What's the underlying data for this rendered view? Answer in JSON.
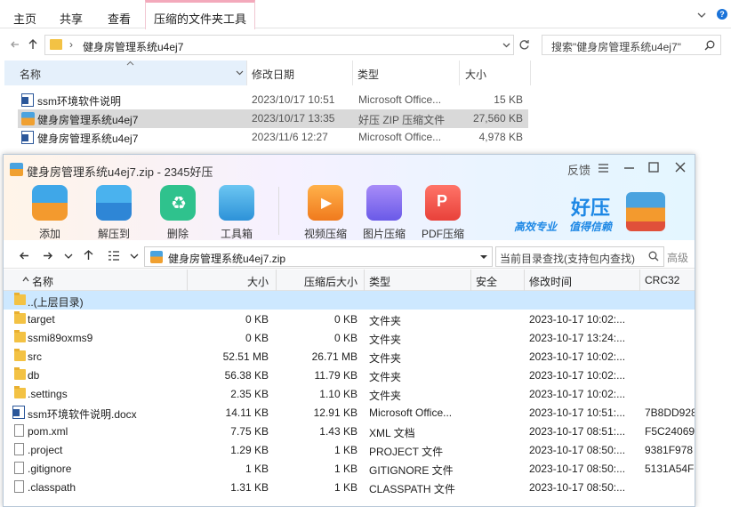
{
  "explorer": {
    "ribbon_tabs": [
      "主页",
      "共享",
      "查看"
    ],
    "active_tab": "压缩的文件夹工具",
    "path_separator": "›",
    "current_folder": "健身房管理系统u4ej7",
    "search_placeholder": "搜索\"健身房管理系统u4ej7\"",
    "columns": {
      "name": "名称",
      "date": "修改日期",
      "type": "类型",
      "size": "大小"
    },
    "files": [
      {
        "name": "ssm环境软件说明",
        "date": "2023/10/17 10:51",
        "type": "Microsoft Office...",
        "size": "15 KB",
        "icon": "word-doc-icon"
      },
      {
        "name": "健身房管理系统u4ej7",
        "date": "2023/10/17 13:35",
        "type": "好压 ZIP 压缩文件",
        "size": "27,560 KB",
        "icon": "zip-archive-icon"
      },
      {
        "name": "健身房管理系统u4ej7",
        "date": "2023/11/6 12:27",
        "type": "Microsoft Office...",
        "size": "4,978 KB",
        "icon": "word-doc-icon"
      }
    ]
  },
  "haozip": {
    "title": "健身房管理系统u4ej7.zip - 2345好压",
    "feedback": "反馈",
    "toolbar": [
      {
        "label": "添加",
        "icon": "add-archive-icon"
      },
      {
        "label": "解压到",
        "icon": "extract-to-icon"
      },
      {
        "label": "删除",
        "icon": "delete-recycle-icon"
      },
      {
        "label": "工具箱",
        "icon": "toolbox-icon"
      },
      {
        "label": "视频压缩",
        "icon": "video-compress-icon"
      },
      {
        "label": "图片压缩",
        "icon": "image-compress-icon"
      },
      {
        "label": "PDF压缩",
        "icon": "pdf-compress-icon"
      }
    ],
    "brand": {
      "name": "好压",
      "slogan1": "高效专业",
      "slogan2": "值得信赖"
    },
    "path": "健身房管理系统u4ej7.zip",
    "search_placeholder": "当前目录查找(支持包内查找)",
    "advanced": "高级",
    "columns": {
      "name": "名称",
      "size": "大小",
      "packed": "压缩后大小",
      "type": "类型",
      "security": "安全",
      "modified": "修改时间",
      "crc": "CRC32"
    },
    "rows": [
      {
        "name": "..(上层目录)",
        "size": "",
        "packed": "",
        "type": "",
        "modified": "",
        "crc": "",
        "icon": "folder"
      },
      {
        "name": "target",
        "size": "0 KB",
        "packed": "0 KB",
        "type": "文件夹",
        "modified": "2023-10-17 10:02:...",
        "crc": "",
        "icon": "folder"
      },
      {
        "name": "ssmi89oxms9",
        "size": "0 KB",
        "packed": "0 KB",
        "type": "文件夹",
        "modified": "2023-10-17 13:24:...",
        "crc": "",
        "icon": "folder"
      },
      {
        "name": "src",
        "size": "52.51 MB",
        "packed": "26.71 MB",
        "type": "文件夹",
        "modified": "2023-10-17 10:02:...",
        "crc": "",
        "icon": "folder"
      },
      {
        "name": "db",
        "size": "56.38 KB",
        "packed": "11.79 KB",
        "type": "文件夹",
        "modified": "2023-10-17 10:02:...",
        "crc": "",
        "icon": "folder"
      },
      {
        "name": ".settings",
        "size": "2.35 KB",
        "packed": "1.10 KB",
        "type": "文件夹",
        "modified": "2023-10-17 10:02:...",
        "crc": "",
        "icon": "folder"
      },
      {
        "name": "ssm环境软件说明.docx",
        "size": "14.11 KB",
        "packed": "12.91 KB",
        "type": "Microsoft Office...",
        "modified": "2023-10-17 10:51:...",
        "crc": "7B8DD928",
        "icon": "word"
      },
      {
        "name": "pom.xml",
        "size": "7.75 KB",
        "packed": "1.43 KB",
        "type": "XML 文档",
        "modified": "2023-10-17 08:51:...",
        "crc": "F5C24069",
        "icon": "file"
      },
      {
        "name": ".project",
        "size": "1.29 KB",
        "packed": "1 KB",
        "type": "PROJECT 文件",
        "modified": "2023-10-17 08:50:...",
        "crc": "9381F978",
        "icon": "file"
      },
      {
        "name": ".gitignore",
        "size": "1 KB",
        "packed": "1 KB",
        "type": "GITIGNORE 文件",
        "modified": "2023-10-17 08:50:...",
        "crc": "5131A54F",
        "icon": "file"
      },
      {
        "name": ".classpath",
        "size": "1.31 KB",
        "packed": "1 KB",
        "type": "CLASSPATH 文件",
        "modified": "2023-10-17 08:50:...",
        "crc": "",
        "icon": "file"
      }
    ]
  }
}
